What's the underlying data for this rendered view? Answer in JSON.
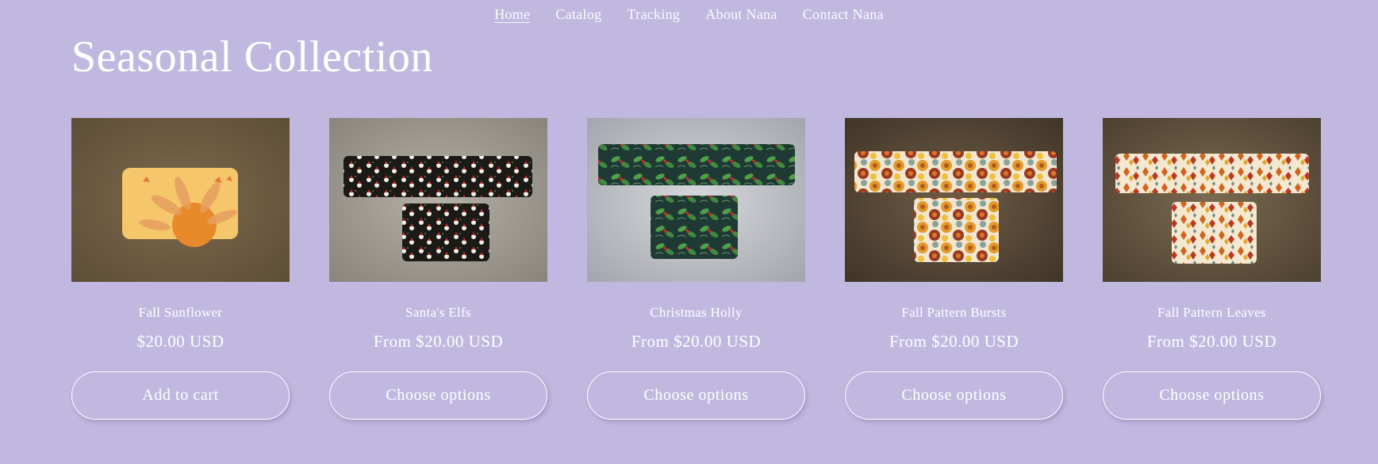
{
  "nav": {
    "items": [
      {
        "label": "Home",
        "active": true
      },
      {
        "label": "Catalog",
        "active": false
      },
      {
        "label": "Tracking",
        "active": false
      },
      {
        "label": "About Nana",
        "active": false
      },
      {
        "label": "Contact Nana",
        "active": false
      }
    ]
  },
  "collection": {
    "title": "Seasonal Collection",
    "products": [
      {
        "name": "Fall Sunflower",
        "price": "$20.00 USD",
        "button": "Add to cart"
      },
      {
        "name": "Santa's Elfs",
        "price": "From $20.00 USD",
        "button": "Choose options"
      },
      {
        "name": "Christmas Holly",
        "price": "From $20.00 USD",
        "button": "Choose options"
      },
      {
        "name": "Fall Pattern Bursts",
        "price": "From $20.00 USD",
        "button": "Choose options"
      },
      {
        "name": "Fall Pattern Leaves",
        "price": "From $20.00 USD",
        "button": "Choose options"
      }
    ]
  },
  "colors": {
    "background": "#c1b8e0",
    "text": "#ffffff"
  }
}
